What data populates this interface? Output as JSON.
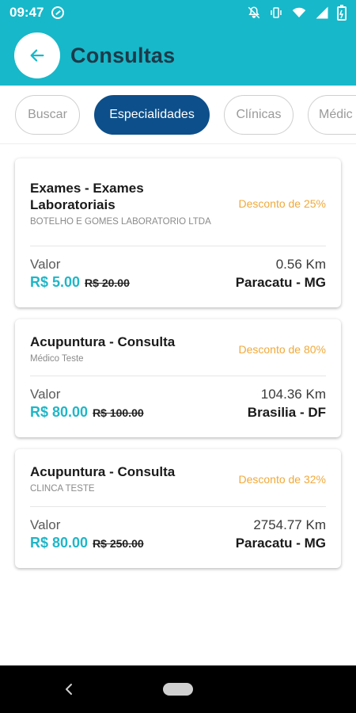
{
  "status_bar": {
    "time": "09:47",
    "bg_color": "#17b8c9"
  },
  "header": {
    "title": "Consultas",
    "back_icon": "arrow-left-icon"
  },
  "tabs": [
    {
      "label": "Buscar",
      "active": false
    },
    {
      "label": "Especialidades",
      "active": true
    },
    {
      "label": "Clínicas",
      "active": false
    },
    {
      "label": "Médic",
      "active": false
    }
  ],
  "cards": [
    {
      "title": "Exames - Exames Laboratoriais",
      "provider": "BOTELHO E GOMES LABORATORIO LTDA",
      "discount": "Desconto de 25%",
      "valor_label": "Valor",
      "price": "R$ 5.00",
      "old_price": "R$ 20.00",
      "distance": "0.56 Km",
      "city": "Paracatu - MG"
    },
    {
      "title": "Acupuntura - Consulta",
      "provider": "Médico Teste",
      "discount": "Desconto de 80%",
      "valor_label": "Valor",
      "price": "R$ 80.00",
      "old_price": "R$ 100.00",
      "distance": "104.36 Km",
      "city": "Brasilia - DF"
    },
    {
      "title": "Acupuntura - Consulta",
      "provider": "CLINCA TESTE",
      "discount": "Desconto de 32%",
      "valor_label": "Valor",
      "price": "R$ 80.00",
      "old_price": "R$ 250.00",
      "distance": "2754.77 Km",
      "city": "Paracatu - MG"
    }
  ],
  "colors": {
    "accent": "#17b8c9",
    "active_tab": "#0d4f8a",
    "discount": "#f0a93a",
    "price": "#1fb6c8"
  }
}
